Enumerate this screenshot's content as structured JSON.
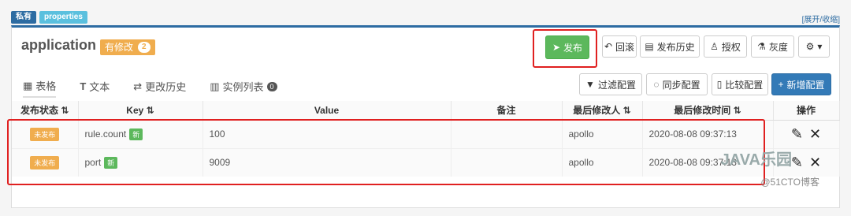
{
  "tags": {
    "private": "私有",
    "format": "properties"
  },
  "expand_link": "[展开/收缩]",
  "namespace": {
    "title": "application",
    "modified_label": "有修改",
    "modified_count": "2"
  },
  "actions": {
    "publish": "发布",
    "rollback": "回滚",
    "history": "发布历史",
    "authorize": "授权",
    "gray": "灰度",
    "settings_caret": "▾"
  },
  "tabs": [
    {
      "label": "表格"
    },
    {
      "label": "文本"
    },
    {
      "label": "更改历史"
    },
    {
      "label": "实例列表",
      "count": "0"
    }
  ],
  "toolbar": {
    "filter": "过滤配置",
    "sync": "同步配置",
    "compare": "比较配置",
    "add": "新增配置"
  },
  "table": {
    "headers": [
      "发布状态",
      "Key",
      "Value",
      "备注",
      "最后修改人",
      "最后修改时间",
      "操作"
    ],
    "sort_icon": "⇅",
    "rows": [
      {
        "status": "未发布",
        "key": "rule.count",
        "new": "新",
        "value": "100",
        "comment": "",
        "modifier": "apollo",
        "time": "2020-08-08 09:37:13"
      },
      {
        "status": "未发布",
        "key": "port",
        "new": "新",
        "value": "9009",
        "comment": "",
        "modifier": "apollo",
        "time": "2020-08-08 09:37:13"
      }
    ]
  },
  "watermark": {
    "brand": "JAVA乐园",
    "source": "@51CTO博客"
  }
}
